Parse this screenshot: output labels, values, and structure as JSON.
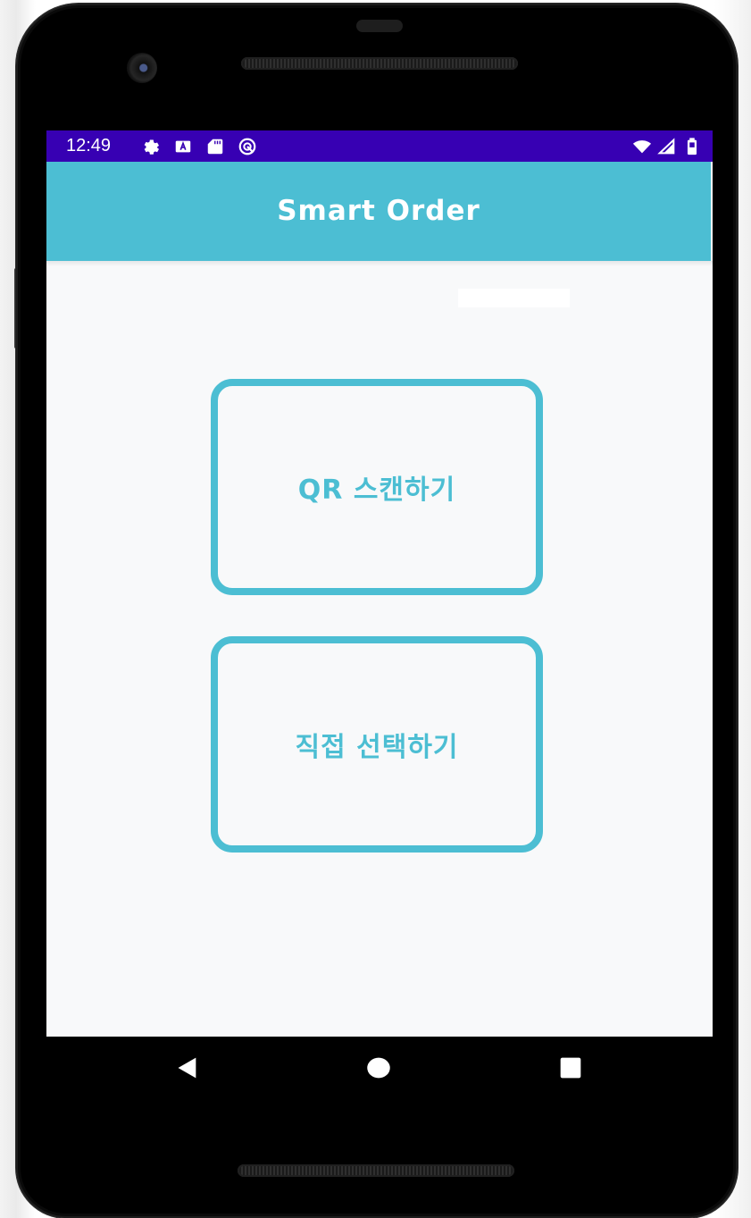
{
  "colors": {
    "status_bar": "#3700b3",
    "app_bar": "#4cbed3",
    "accent": "#4cbed3",
    "background": "#f8f9fa"
  },
  "status_bar": {
    "time": "12:49",
    "left_icons": [
      "settings-icon",
      "font-a-icon",
      "sd-card-icon",
      "sync-icon"
    ],
    "right_icons": [
      "wifi-icon",
      "cell-signal-icon",
      "battery-icon"
    ]
  },
  "app_bar": {
    "title": "Smart Order"
  },
  "main": {
    "qr_button_label": "QR 스캔하기",
    "direct_button_label": "직접 선택하기"
  },
  "nav_bar": {
    "buttons": [
      "back-icon",
      "home-icon",
      "recent-apps-icon"
    ]
  }
}
